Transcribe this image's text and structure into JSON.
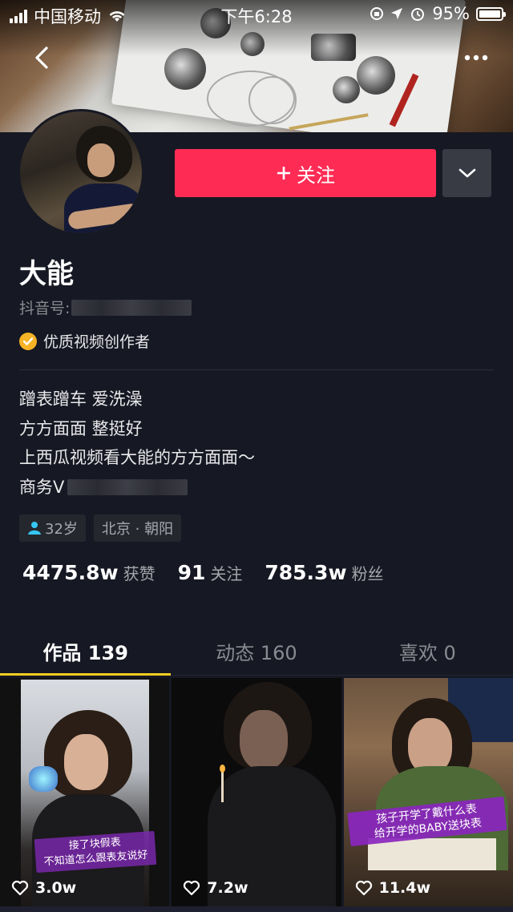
{
  "status_bar": {
    "carrier": "中国移动",
    "time": "下午6:28",
    "battery": "95%"
  },
  "profile": {
    "name": "大能",
    "id_label": "抖音号:",
    "certification": "优质视频创作者",
    "bio_lines": [
      "蹭表蹭车 爱洗澡",
      "方方面面 整挺好",
      "上西瓜视频看大能的方方面面～",
      "商务V"
    ],
    "tags": {
      "age": "32岁",
      "location": "北京 · 朝阳"
    }
  },
  "actions": {
    "follow_label": "关注",
    "follow_icon": "plus-icon"
  },
  "stats": [
    {
      "num": "4475.8w",
      "label": "获赞"
    },
    {
      "num": "91",
      "label": "关注"
    },
    {
      "num": "785.3w",
      "label": "粉丝"
    }
  ],
  "tabs": [
    {
      "label": "作品 139",
      "active": true
    },
    {
      "label": "动态 160",
      "active": false
    },
    {
      "label": "喜欢 0",
      "active": false
    }
  ],
  "videos": [
    {
      "likes": "3.0w",
      "caption_lines": [
        "接了块假表",
        "不知道怎么跟表友说好"
      ]
    },
    {
      "likes": "7.2w"
    },
    {
      "likes": "11.4w",
      "caption_lines": [
        "孩子开学了戴什么表",
        "给开学的BABY送块表"
      ]
    }
  ],
  "colors": {
    "background": "#161823",
    "accent": "#fe2c55",
    "tab_indicator": "#facd1f",
    "badge": "#f6b325"
  }
}
